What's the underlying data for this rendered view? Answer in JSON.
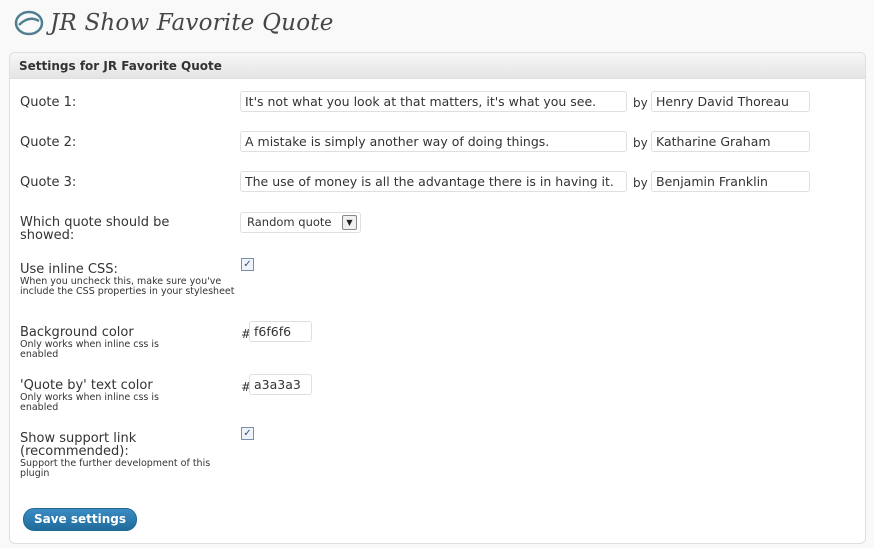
{
  "page": {
    "title": "JR Show Favorite Quote"
  },
  "panel": {
    "heading": "Settings for JR Favorite Quote"
  },
  "quotes": [
    {
      "label": "Quote 1:",
      "text": "It's not what you look at that matters, it's what you see.",
      "by_label": "by",
      "author": "Henry David Thoreau"
    },
    {
      "label": "Quote 2:",
      "text": "A mistake is simply another way of doing things.",
      "by_label": "by",
      "author": "Katharine Graham"
    },
    {
      "label": "Quote 3:",
      "text": "The use of money is all the advantage there is in having it.",
      "by_label": "by",
      "author": "Benjamin Franklin"
    }
  ],
  "which_quote": {
    "label": "Which quote should be showed:",
    "selected": "Random quote"
  },
  "inline_css": {
    "label": "Use inline CSS:",
    "hint": "When you uncheck this, make sure you've include the CSS properties in your stylesheet",
    "checked": true
  },
  "bg_color": {
    "label": "Background color",
    "hint": "Only works when inline css is enabled",
    "prefix": "#",
    "value": "f6f6f6"
  },
  "quoteby_color": {
    "label": "'Quote by' text color",
    "hint": "Only works when inline css is enabled",
    "prefix": "#",
    "value": "a3a3a3"
  },
  "support_link": {
    "label": "Show support link (recommended):",
    "hint": "Support the further development of this plugin",
    "checked": true
  },
  "save_button": "Save settings"
}
